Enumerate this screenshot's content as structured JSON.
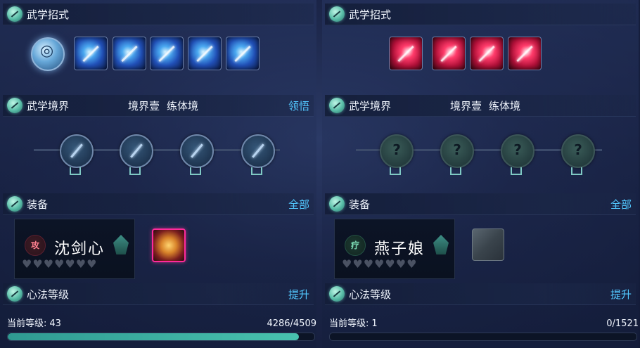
{
  "panels": [
    {
      "id": "left",
      "skills_header": "武学招式",
      "realm_header": "武学境界",
      "realm_stage": "境界壹",
      "realm_name": "练体境",
      "realm_action": "领悟",
      "equip_header": "装备",
      "equip_action": "全部",
      "character": {
        "element": "攻",
        "name": "沈剑心"
      },
      "equip_item": "equipment-gold-armor",
      "xinfa_header": "心法等级",
      "xinfa_action": "提升",
      "level_label": "当前等级:",
      "level_value": "43",
      "progress_text": "4286/4509",
      "progress": 0.9506
    },
    {
      "id": "right",
      "skills_header": "武学招式",
      "realm_header": "武学境界",
      "realm_stage": "境界壹",
      "realm_name": "练体境",
      "realm_action": "",
      "equip_header": "装备",
      "equip_action": "全部",
      "character": {
        "element": "疗",
        "name": "燕子娘"
      },
      "equip_item": "equipment-empty-slot",
      "xinfa_header": "心法等级",
      "xinfa_action": "提升",
      "level_label": "当前等级:",
      "level_value": "1",
      "progress_text": "0/1521",
      "progress": 0
    }
  ],
  "hearts": "♥♥♥♥♥♥♥",
  "colors": {
    "accent": "#52c8ff",
    "progress": "#48c2ae",
    "rare_border": "#ff2a9b"
  }
}
